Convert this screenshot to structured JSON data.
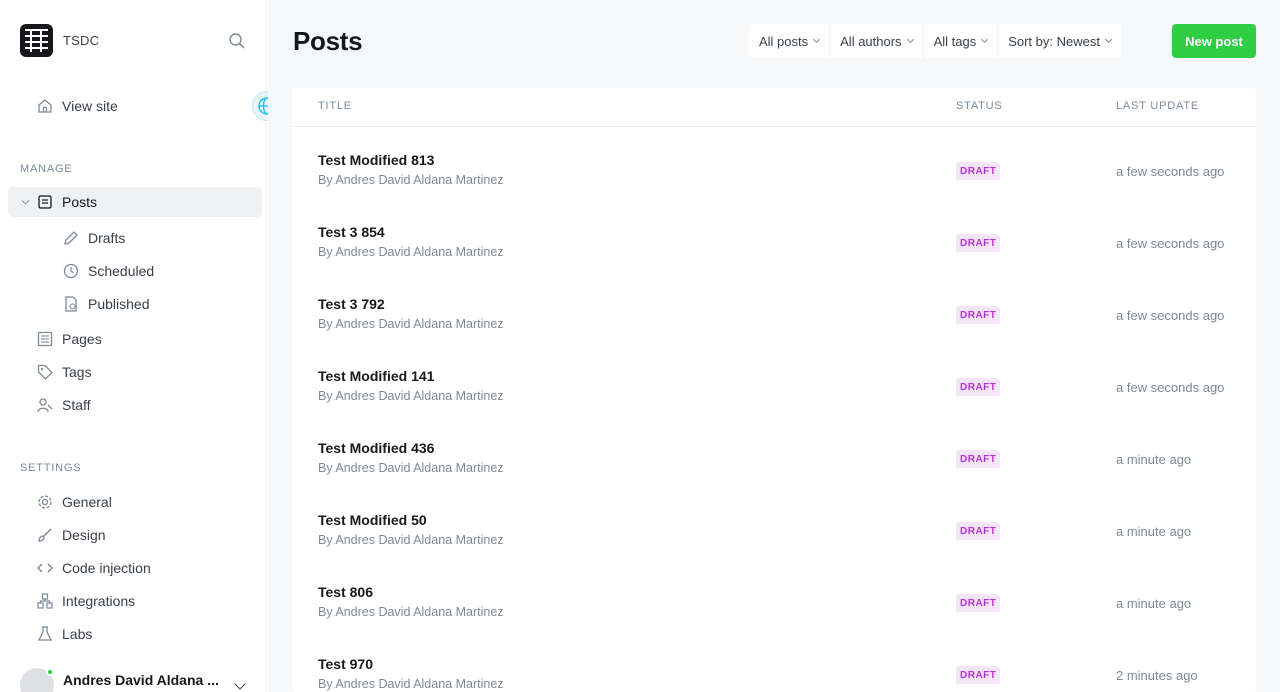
{
  "sidebar": {
    "site_name": "TSDC",
    "view_site_label": "View site",
    "manage_label": "MANAGE",
    "settings_label": "SETTINGS",
    "manage_items": [
      {
        "label": "Posts",
        "icon": "posts-icon"
      },
      {
        "label": "Drafts",
        "icon": "pen-icon"
      },
      {
        "label": "Scheduled",
        "icon": "clock-icon"
      },
      {
        "label": "Published",
        "icon": "published-icon"
      },
      {
        "label": "Pages",
        "icon": "pages-icon"
      },
      {
        "label": "Tags",
        "icon": "tag-icon"
      },
      {
        "label": "Staff",
        "icon": "staff-icon"
      }
    ],
    "settings_items": [
      {
        "label": "General",
        "icon": "gear-icon"
      },
      {
        "label": "Design",
        "icon": "brush-icon"
      },
      {
        "label": "Code injection",
        "icon": "code-icon"
      },
      {
        "label": "Integrations",
        "icon": "integrations-icon"
      },
      {
        "label": "Labs",
        "icon": "flask-icon"
      }
    ],
    "user_name": "Andres David Aldana ..."
  },
  "header": {
    "title": "Posts",
    "filters": [
      "All posts",
      "All authors",
      "All tags",
      "Sort by: Newest"
    ],
    "new_post_label": "New post"
  },
  "table": {
    "columns": [
      "TITLE",
      "STATUS",
      "LAST UPDATE"
    ],
    "rows": [
      {
        "title": "Test Modified 813",
        "byline": "By Andres David Aldana Martinez",
        "status": "DRAFT",
        "updated": "a few seconds ago"
      },
      {
        "title": "Test 3 854",
        "byline": "By Andres David Aldana Martinez",
        "status": "DRAFT",
        "updated": "a few seconds ago"
      },
      {
        "title": "Test 3 792",
        "byline": "By Andres David Aldana Martinez",
        "status": "DRAFT",
        "updated": "a few seconds ago"
      },
      {
        "title": "Test Modified 141",
        "byline": "By Andres David Aldana Martinez",
        "status": "DRAFT",
        "updated": "a few seconds ago"
      },
      {
        "title": "Test Modified 436",
        "byline": "By Andres David Aldana Martinez",
        "status": "DRAFT",
        "updated": "a minute ago"
      },
      {
        "title": "Test Modified 50",
        "byline": "By Andres David Aldana Martinez",
        "status": "DRAFT",
        "updated": "a minute ago"
      },
      {
        "title": "Test 806",
        "byline": "By Andres David Aldana Martinez",
        "status": "DRAFT",
        "updated": "a minute ago"
      },
      {
        "title": "Test 970",
        "byline": "By Andres David Aldana Martinez",
        "status": "DRAFT",
        "updated": "2 minutes ago"
      }
    ]
  },
  "colors": {
    "accent_green": "#30cf43",
    "draft_badge_bg": "#f4e6f8",
    "draft_badge_text": "#b335d5"
  }
}
